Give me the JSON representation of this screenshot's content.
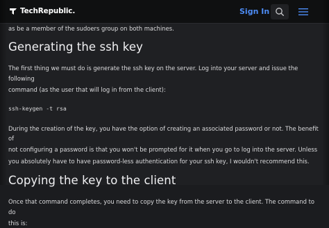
{
  "header": {
    "logo_text": "TechRepublic.",
    "signin_label": "Sign In",
    "search_icon": "search-icon",
    "menu_icon": "hamburger-menu-icon",
    "accent_color": "#4d8cf5"
  },
  "article": {
    "para_top": "as be a member of the sudoers group on both machines.",
    "heading1": "Generating the ssh key",
    "para1_line1": "The first thing we must do is generate the ssh key on the server. Log into your server and issue the following",
    "para1_line2": "command (as the user that will log in from the client):",
    "code1": "ssh-keygen -t rsa",
    "para2_line1": "During the creation of the key, you have the option of creating an associated password or not. The benefit of",
    "para2_line2": "not configuring a password is that you won't be prompted for it when you go to log into the server. Unless",
    "para2_line3": "you absolutely have to have password-less authentication for your ssh key, I wouldn't recommend this.",
    "heading2": "Copying the key to the client",
    "para3_line1": "Once that command completes, you need to copy the key from the server to the client. The command to do",
    "para3_line2": "this is:"
  }
}
